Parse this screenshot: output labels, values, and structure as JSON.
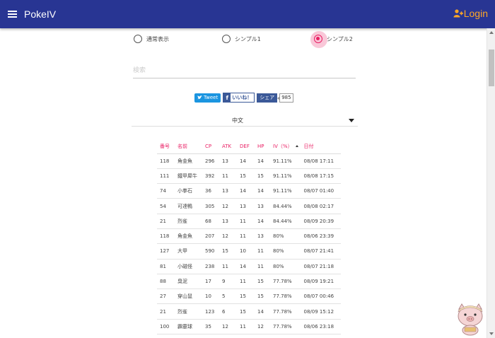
{
  "appbar": {
    "title": "PokeIV",
    "login_label": "Login",
    "color": "#283593",
    "login_color": "#ffa726"
  },
  "view_modes": [
    {
      "label": "通常表示",
      "checked": false
    },
    {
      "label": "シンプル1",
      "checked": false
    },
    {
      "label": "シンプル2",
      "checked": true
    }
  ],
  "search": {
    "placeholder": "検索",
    "value": ""
  },
  "share": {
    "tweet_label": "Tweet",
    "like_label": "いいね！",
    "share_label": "シェア",
    "count": "985"
  },
  "language": {
    "selected": "中文"
  },
  "table": {
    "headers": [
      "番号",
      "名前",
      "CP",
      "ATK",
      "DEF",
      "HP",
      "IV（%）",
      "日付"
    ],
    "rows": [
      [
        "118",
        "角金魚",
        "296",
        "13",
        "14",
        "14",
        "91.11%",
        "08/08 17:11"
      ],
      [
        "111",
        "鐵甲犀牛",
        "392",
        "11",
        "15",
        "15",
        "91.11%",
        "08/08 17:15"
      ],
      [
        "74",
        "小拳石",
        "36",
        "13",
        "14",
        "14",
        "91.11%",
        "08/07 01:40"
      ],
      [
        "54",
        "可達鴨",
        "305",
        "12",
        "13",
        "13",
        "84.44%",
        "08/08 02:17"
      ],
      [
        "21",
        "烈雀",
        "68",
        "13",
        "11",
        "14",
        "84.44%",
        "08/09 20:39"
      ],
      [
        "118",
        "角金魚",
        "207",
        "12",
        "11",
        "13",
        "80%",
        "08/06 23:39"
      ],
      [
        "127",
        "大甲",
        "590",
        "15",
        "10",
        "11",
        "80%",
        "08/07 21:41"
      ],
      [
        "81",
        "小磁怪",
        "238",
        "11",
        "14",
        "11",
        "80%",
        "08/07 21:18"
      ],
      [
        "88",
        "臭泥",
        "17",
        "9",
        "11",
        "15",
        "77.78%",
        "08/09 19:21"
      ],
      [
        "27",
        "穿山鼠",
        "10",
        "5",
        "15",
        "15",
        "77.78%",
        "08/07 00:46"
      ],
      [
        "21",
        "烈雀",
        "123",
        "6",
        "15",
        "14",
        "77.78%",
        "08/09 15:12"
      ],
      [
        "100",
        "霹靂球",
        "35",
        "12",
        "11",
        "12",
        "77.78%",
        "08/06 23:18"
      ]
    ]
  }
}
